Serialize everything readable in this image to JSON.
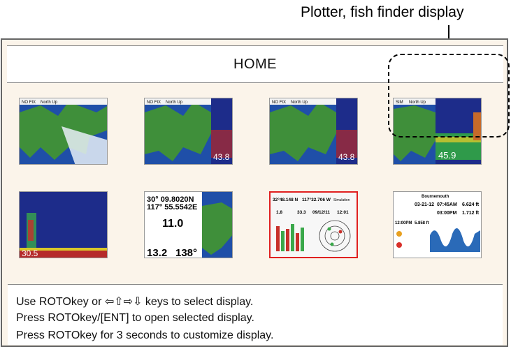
{
  "callout": {
    "label": "Plotter, fish finder display"
  },
  "screen": {
    "title": "HOME"
  },
  "thumbnails": [
    {
      "kind": "chart",
      "status": "NO FIX",
      "mode": "North Up"
    },
    {
      "kind": "chart+fishfinder",
      "status": "NO FIX",
      "mode": "North Up",
      "depth": "43.8"
    },
    {
      "kind": "chart+fishfinder",
      "status": "NO FIX",
      "mode": "North Up",
      "depth": "43.8"
    },
    {
      "kind": "chart+fishfinder",
      "status": "SIM",
      "mode": "North Up",
      "depth": "45.9"
    },
    {
      "kind": "fishfinder",
      "depth": "30.5"
    },
    {
      "kind": "nav-data",
      "lat": "30° 09.8020N",
      "lon": "117° 55.5542E",
      "sog": "11.0",
      "depth": "13.2",
      "cog": "138°"
    },
    {
      "kind": "instruments",
      "lat": "32°48.148 N",
      "lon": "117°32.706 W",
      "mode": "Simulation",
      "v1": "1.8",
      "v2": "33.3",
      "date": "09/12/11",
      "time": "12:01"
    },
    {
      "kind": "tide",
      "place": "Bournemouth",
      "date": "03-21-12",
      "high_tide": "07:45AM",
      "high_height": "6.624 ft",
      "low_tide": "03:00PM",
      "low_height": "1.712 ft",
      "pred_time": "12:00PM",
      "pred_height": "5.858 ft"
    }
  ],
  "instructions": [
    "Use ROTOkey or ⇦⇧⇨⇩ keys to select display.",
    "Press ROTOkey/[ENT] to open selected display.",
    "Press ROTOkey for 3 seconds to customize display."
  ],
  "colors": {
    "sea": "#1f4fa8",
    "land": "#3f8f3a",
    "fishfinder_bg": "#1d2c8a",
    "red_frame": "#e02020"
  }
}
